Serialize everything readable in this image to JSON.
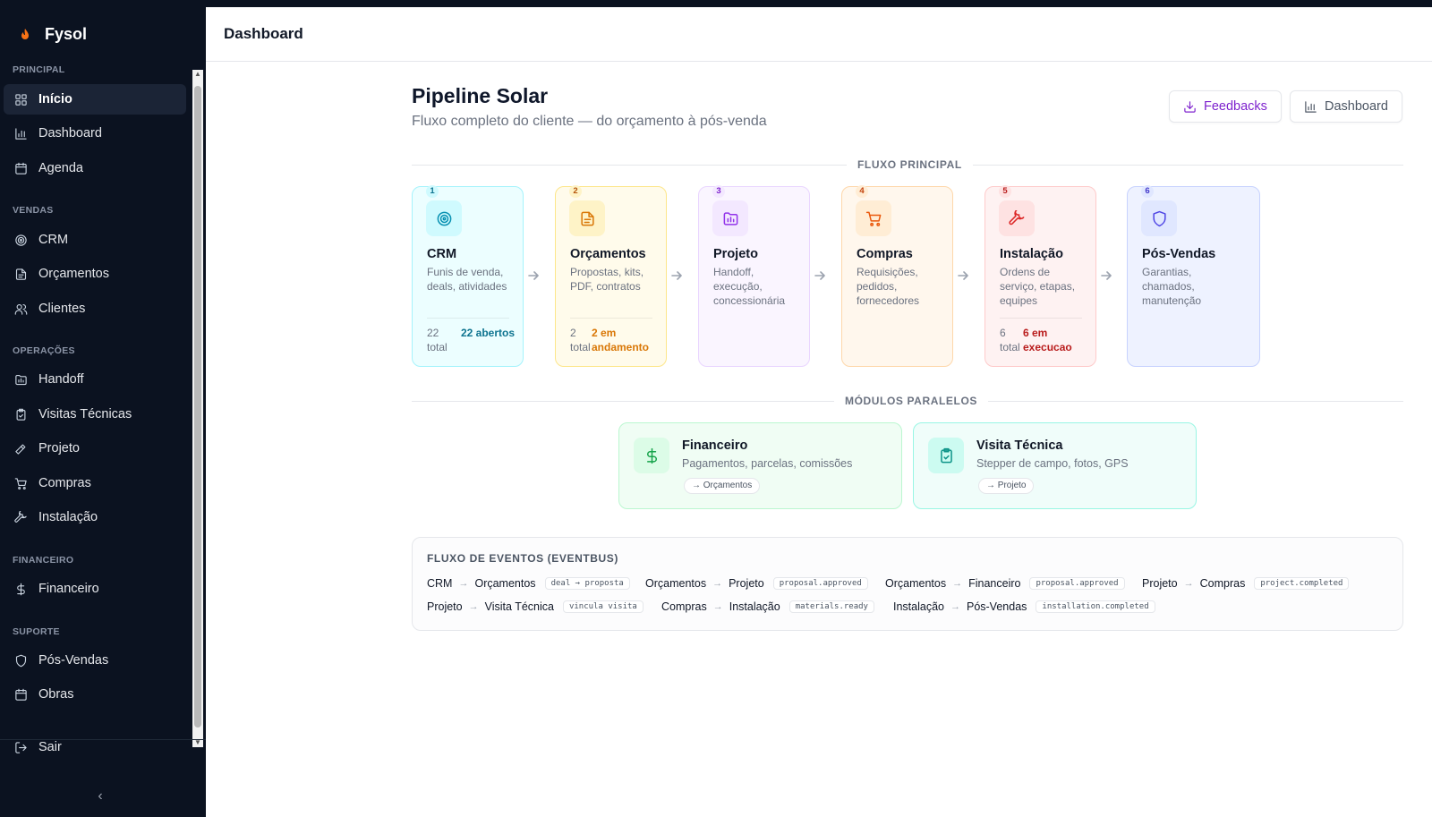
{
  "app": {
    "name": "Fysol"
  },
  "sidebar": {
    "sections": [
      {
        "label": "PRINCIPAL"
      },
      {
        "label": "VENDAS"
      },
      {
        "label": "OPERAÇÕES"
      },
      {
        "label": "FINANCEIRO"
      },
      {
        "label": "SUPORTE"
      }
    ],
    "items": [
      {
        "label": "Início",
        "icon": "grid-icon",
        "active": true
      },
      {
        "label": "Dashboard",
        "icon": "bar-chart-icon"
      },
      {
        "label": "Agenda",
        "icon": "calendar-icon"
      },
      {
        "label": "CRM",
        "icon": "target-icon"
      },
      {
        "label": "Orçamentos",
        "icon": "document-icon"
      },
      {
        "label": "Clientes",
        "icon": "users-icon"
      },
      {
        "label": "Handoff",
        "icon": "folder-icon"
      },
      {
        "label": "Visitas Técnicas",
        "icon": "clipboard-check-icon"
      },
      {
        "label": "Projeto",
        "icon": "hammer-icon"
      },
      {
        "label": "Compras",
        "icon": "cart-icon"
      },
      {
        "label": "Instalação",
        "icon": "wrench-icon"
      },
      {
        "label": "Financeiro",
        "icon": "dollar-icon"
      },
      {
        "label": "Pós-Vendas",
        "icon": "shield-icon"
      },
      {
        "label": "Obras",
        "icon": "calendar-icon"
      }
    ],
    "logout": "Sair"
  },
  "header": {
    "title": "Dashboard"
  },
  "main": {
    "title": "Pipeline Solar",
    "subtitle": "Fluxo completo do cliente — do orçamento à pós-venda",
    "buttons": {
      "feedbacks": "Feedbacks",
      "dashboard": "Dashboard"
    },
    "flow_label": "FLUXO PRINCIPAL",
    "stages": [
      {
        "num": "1",
        "title": "CRM",
        "desc": "Funis de venda, deals, atividades",
        "total": "22 total",
        "status": "22 abertos",
        "color": "#0891b2"
      },
      {
        "num": "2",
        "title": "Orçamentos",
        "desc": "Propostas, kits, PDF, contratos",
        "total": "2 total",
        "status": "2 em andamento",
        "color": "#d97706"
      },
      {
        "num": "3",
        "title": "Projeto",
        "desc": "Handoff, execução, concessionária",
        "total": "",
        "status": "",
        "color": "#9333ea"
      },
      {
        "num": "4",
        "title": "Compras",
        "desc": "Requisições, pedidos, fornecedores",
        "total": "",
        "status": "",
        "color": "#ea580c"
      },
      {
        "num": "5",
        "title": "Instalação",
        "desc": "Ordens de serviço, etapas, equipes",
        "total": "6 total",
        "status": "6 em execucao",
        "color": "#dc2626"
      },
      {
        "num": "6",
        "title": "Pós-Vendas",
        "desc": "Garantias, chamados, manutenção",
        "total": "",
        "status": "",
        "color": "#4f46e5"
      }
    ],
    "parallel_label": "MÓDULOS PARALELOS",
    "modules": [
      {
        "title": "Financeiro",
        "desc": "Pagamentos, parcelas, comissões",
        "link": "Orçamentos",
        "color": "#16a34a"
      },
      {
        "title": "Visita Técnica",
        "desc": "Stepper de campo, fotos, GPS",
        "link": "Projeto",
        "color": "#0d9488"
      }
    ],
    "events": {
      "title": "FLUXO DE EVENTOS (EVENTBUS)",
      "items": [
        {
          "from": "CRM",
          "to": "Orçamentos",
          "event": "deal → proposta"
        },
        {
          "from": "Orçamentos",
          "to": "Projeto",
          "event": "proposal.approved"
        },
        {
          "from": "Orçamentos",
          "to": "Financeiro",
          "event": "proposal.approved"
        },
        {
          "from": "Projeto",
          "to": "Compras",
          "event": "project.completed"
        },
        {
          "from": "Projeto",
          "to": "Visita Técnica",
          "event": "vincula visita"
        },
        {
          "from": "Compras",
          "to": "Instalação",
          "event": "materials.ready"
        },
        {
          "from": "Instalação",
          "to": "Pós-Vendas",
          "event": "installation.completed"
        }
      ]
    }
  }
}
